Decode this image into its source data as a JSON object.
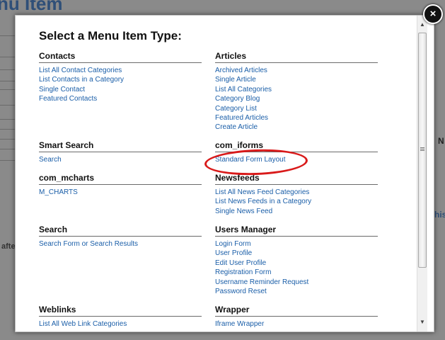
{
  "background": {
    "title_fragment": "nu Item",
    "right_fragment_1": "N",
    "right_fragment_2": "his",
    "left_fragment": "afte"
  },
  "dialog": {
    "title": "Select a Menu Item Type:",
    "close_symbol": "×",
    "sections": [
      {
        "heading": "Contacts",
        "items": [
          "List All Contact Categories",
          "List Contacts in a Category",
          "Single Contact",
          "Featured Contacts"
        ]
      },
      {
        "heading": "Articles",
        "items": [
          "Archived Articles",
          "Single Article",
          "List All Categories",
          "Category Blog",
          "Category List",
          "Featured Articles",
          "Create Article"
        ]
      },
      {
        "heading": "Smart Search",
        "items": [
          "Search"
        ]
      },
      {
        "heading": "com_iforms",
        "items": [
          "Standard Form Layout"
        ]
      },
      {
        "heading": "com_mcharts",
        "items": [
          "M_CHARTS"
        ]
      },
      {
        "heading": "Newsfeeds",
        "items": [
          "List All News Feed Categories",
          "List News Feeds in a Category",
          "Single News Feed"
        ]
      },
      {
        "heading": "Search",
        "items": [
          "Search Form or Search Results"
        ]
      },
      {
        "heading": "Users Manager",
        "items": [
          "Login Form",
          "User Profile",
          "Edit User Profile",
          "Registration Form",
          "Username Reminder Request",
          "Password Reset"
        ]
      },
      {
        "heading": "Weblinks",
        "items": [
          "List All Web Link Categories"
        ]
      },
      {
        "heading": "Wrapper",
        "items": [
          "Iframe Wrapper"
        ]
      }
    ]
  },
  "scrollbar": {
    "up_symbol": "▲",
    "down_symbol": "▼"
  },
  "annotation": {
    "color": "#d91a1a",
    "target": "Standard Form Layout"
  }
}
